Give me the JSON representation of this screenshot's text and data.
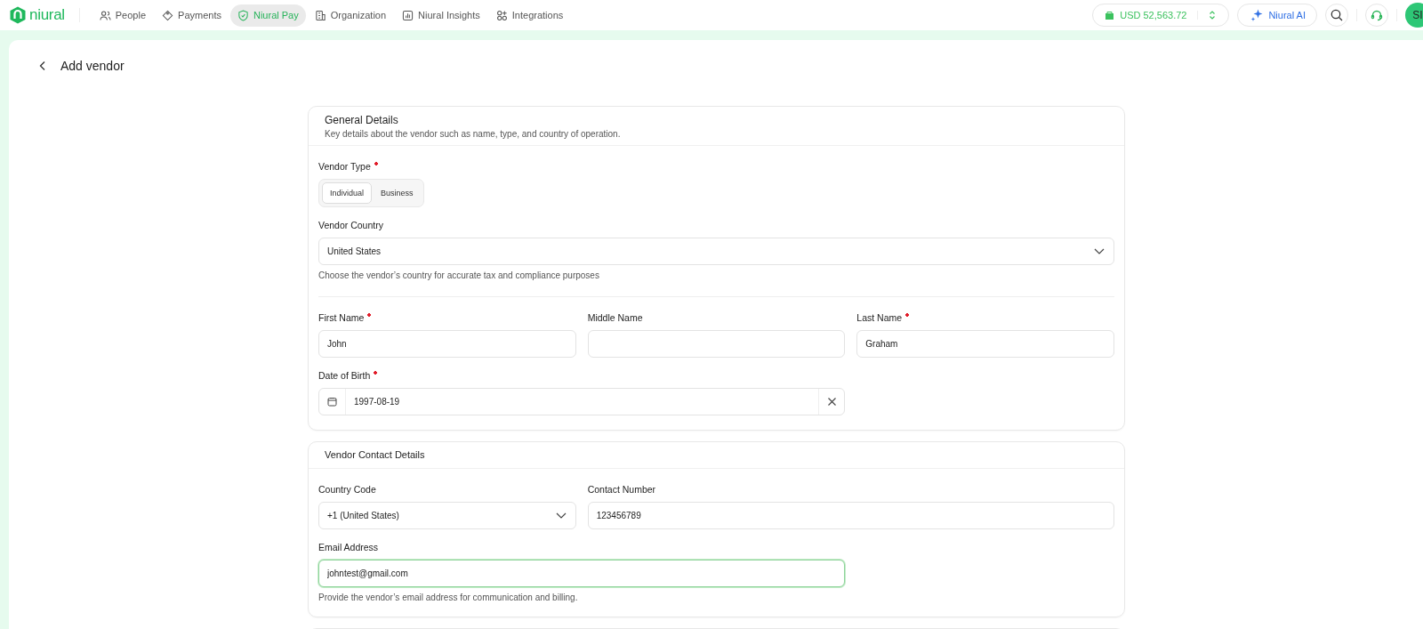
{
  "nav": {
    "brand": "niural",
    "items": [
      {
        "label": "People",
        "selected": false
      },
      {
        "label": "Payments",
        "selected": false
      },
      {
        "label": "Niural Pay",
        "selected": true
      },
      {
        "label": "Organization",
        "selected": false
      },
      {
        "label": "Niural Insights",
        "selected": false
      },
      {
        "label": "Integrations",
        "selected": false
      }
    ],
    "balance": "USD 52,563.72",
    "ai_button": "Niural AI",
    "avatar": "SI"
  },
  "page": {
    "title": "Add vendor"
  },
  "sections": [
    {
      "title": "General Details",
      "subtitle": "Key details about the vendor such as name, type, and country of operation.",
      "groups": [
        {
          "rows": [
            [
              {
                "kind": "segmented",
                "label": "Vendor Type",
                "required": true,
                "options": [
                  {
                    "label": "Individual",
                    "selected": true
                  },
                  {
                    "label": "Business",
                    "selected": false
                  }
                ]
              }
            ],
            [
              {
                "kind": "select",
                "label": "Vendor Country",
                "required": false,
                "value": "United States",
                "hint": "Choose the vendor’s country for accurate tax and compliance purposes"
              }
            ]
          ]
        },
        {
          "rows": [
            [
              {
                "kind": "text",
                "label": "First Name",
                "required": true,
                "value": "John",
                "focused": false
              },
              {
                "kind": "text",
                "label": "Middle Name",
                "required": false,
                "focused": false
              },
              {
                "kind": "text",
                "label": "Last Name",
                "required": true,
                "value": "Graham",
                "focused": false
              }
            ],
            [
              {
                "kind": "date",
                "label": "Date of Birth",
                "required": true,
                "value": "1997-08-19"
              }
            ]
          ]
        }
      ]
    },
    {
      "title": "Vendor Contact Details",
      "groups": [
        {
          "rows": [
            [
              {
                "kind": "select",
                "label": "Country Code",
                "required": false,
                "value": "+1 (United States)"
              },
              {
                "kind": "text",
                "label": "Contact Number",
                "required": false,
                "value": "123456789",
                "focused": false
              }
            ],
            [
              {
                "kind": "text",
                "label": "Email Address",
                "required": false,
                "value": "johntest@gmail.com",
                "focused": true,
                "hint": "Provide the vendor’s email address for communication and billing."
              }
            ]
          ]
        }
      ]
    }
  ]
}
